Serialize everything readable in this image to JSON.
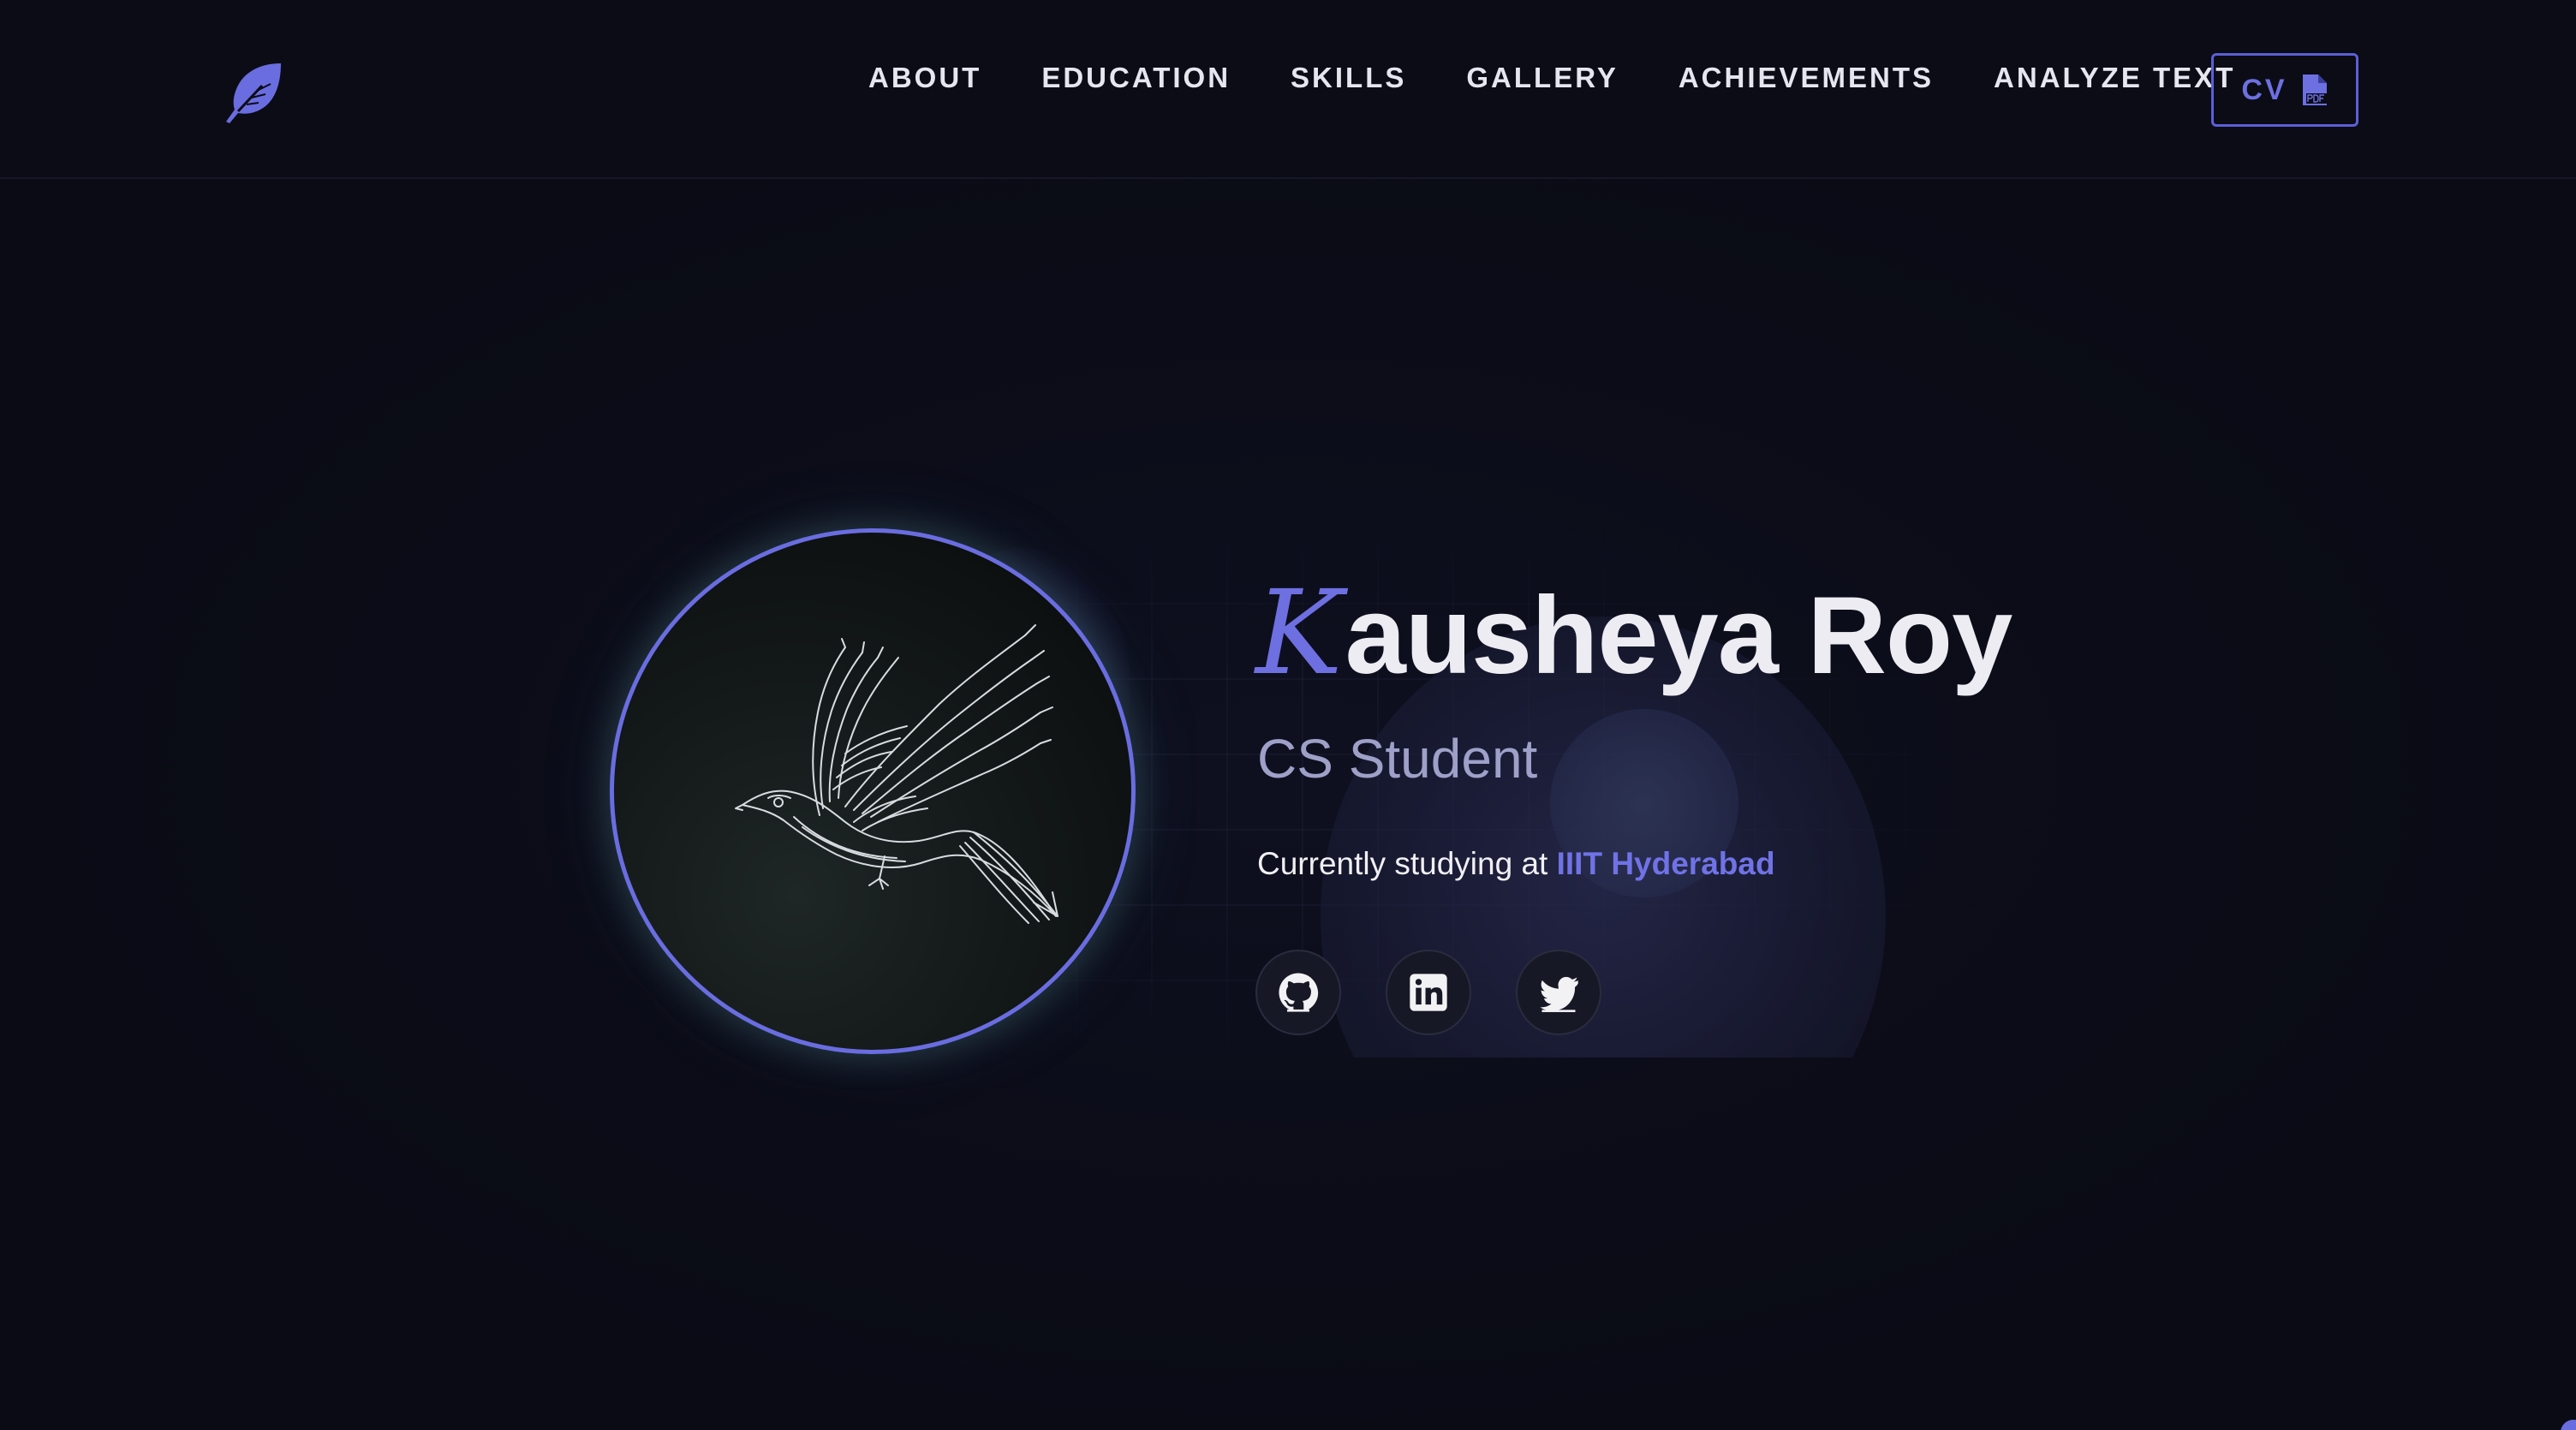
{
  "nav": {
    "logo_icon": "feather-icon",
    "links": [
      {
        "label": "ABOUT"
      },
      {
        "label": "EDUCATION"
      },
      {
        "label": "SKILLS"
      },
      {
        "label": "GALLERY"
      },
      {
        "label": "ACHIEVEMENTS"
      },
      {
        "label": "ANALYZE TEXT"
      }
    ],
    "cv_button": {
      "label": "CV",
      "icon": "pdf-file-icon"
    }
  },
  "hero": {
    "avatar_icon": "bird-line-art",
    "name_initial": "K",
    "name_rest": "ausheya Roy",
    "role": "CS Student",
    "studying_prefix": "Currently studying at ",
    "institution": "IIIT Hyderabad",
    "socials": [
      {
        "icon": "github-icon"
      },
      {
        "icon": "linkedin-icon"
      },
      {
        "icon": "twitter-icon"
      }
    ]
  },
  "colors": {
    "background": "#0b0c16",
    "accent": "#6a6de0",
    "text": "#ececf2",
    "muted": "#9ea0c8"
  }
}
